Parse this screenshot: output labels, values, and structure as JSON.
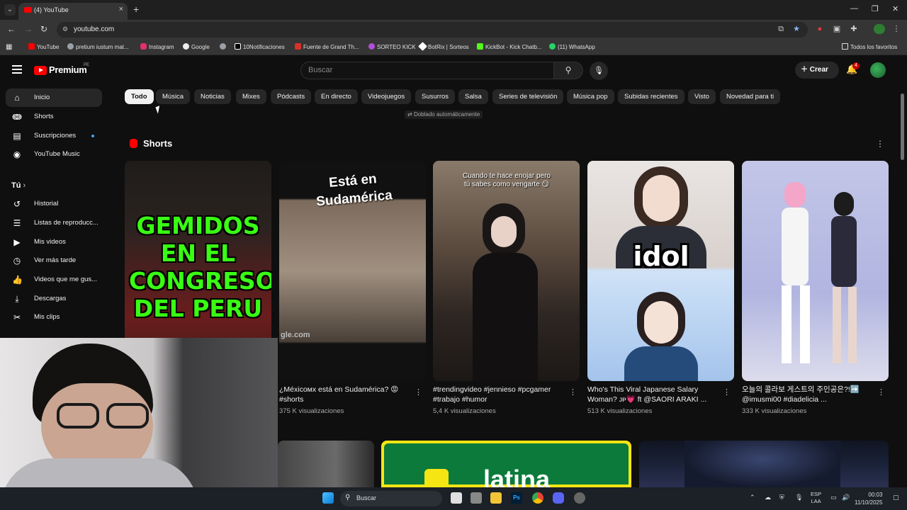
{
  "browser": {
    "tab_title": "(4) YouTube",
    "url": "youtube.com",
    "bookmarks": [
      {
        "label": "YouTube",
        "color": "#ff0000"
      },
      {
        "label": "pretium iustum mat...",
        "color": "#9aa0a6"
      },
      {
        "label": "Instagram",
        "color": "#e1306c"
      },
      {
        "label": "Google",
        "color": "#4285f4"
      },
      {
        "label": "",
        "color": "#9aa0a6"
      },
      {
        "label": "10Notificaciones",
        "color": "#ffffff"
      },
      {
        "label": "Fuente de Grand Th...",
        "color": "#d93025"
      },
      {
        "label": "SORTEO KICK",
        "color": "#b14fd8"
      },
      {
        "label": "BotRix | Sorteos",
        "color": "#ffffff"
      },
      {
        "label": "KickBot - Kick Chatb...",
        "color": "#53fc18"
      },
      {
        "label": "(11) WhatsApp",
        "color": "#25d366"
      }
    ],
    "all_bookmarks": "Todos los favoritos"
  },
  "header": {
    "logo_text": "Premium",
    "region": "PE",
    "search_placeholder": "Buscar",
    "create_label": "Crear",
    "notifications_count": "4"
  },
  "sidebar": {
    "items": [
      {
        "label": "Inicio",
        "icon": "home-icon"
      },
      {
        "label": "Shorts",
        "icon": "shorts-icon"
      },
      {
        "label": "Suscripciones",
        "icon": "subscriptions-icon"
      },
      {
        "label": "YouTube Music",
        "icon": "music-icon"
      }
    ],
    "you_label": "Tú",
    "you_items": [
      {
        "label": "Historial",
        "icon": "history-icon"
      },
      {
        "label": "Listas de reproducc...",
        "icon": "playlist-icon"
      },
      {
        "label": "Mis videos",
        "icon": "my-videos-icon"
      },
      {
        "label": "Ver más tarde",
        "icon": "watch-later-icon"
      },
      {
        "label": "Videos que me gus...",
        "icon": "like-icon"
      },
      {
        "label": "Descargas",
        "icon": "download-icon"
      },
      {
        "label": "Mis clips",
        "icon": "clips-icon"
      }
    ]
  },
  "chips": [
    "Todo",
    "Música",
    "Noticias",
    "Mixes",
    "Pódcasts",
    "En directo",
    "Videojuegos",
    "Susurros",
    "Salsa",
    "Series de televisión",
    "Música pop",
    "Subidas recientes",
    "Visto",
    "Novedad para ti"
  ],
  "dubbed_label": "Doblado automáticamente",
  "shorts": {
    "title": "Shorts",
    "items": [
      {
        "overlay": "GEMIDOS EN EL CONGRESO DEL PERU",
        "title": "",
        "views": ""
      },
      {
        "overlay": "Está en Sudamérica",
        "watermark": "gle.com",
        "title": "¿Méxicoᴍx está en Sudamérica? 😡 #shorts",
        "views": "375 K visualizaciones"
      },
      {
        "overlay": "Cuando te hace enojar pero tú sabes como vengarte 😏",
        "title": "#trendingvideo #jennieso #pcgamer #trabajo #humor",
        "views": "5,4 K visualizaciones"
      },
      {
        "overlay": "idol",
        "title": "Who's This Viral Japanese Salary Woman? ᴊᴘ💗 ft @SAORI ARAKI ...",
        "views": "513 K visualizaciones"
      },
      {
        "overlay": "",
        "title": "오늘의 콜라보 게스트의 주인공은?!➡️ @imusmi00 #diadelicia ...",
        "views": "333 K visualizaciones"
      }
    ]
  },
  "row2": {
    "banner_text": "latina"
  },
  "taskbar": {
    "search_placeholder": "Buscar",
    "lang": "ESP",
    "lang2": "LAA",
    "time": "00:03",
    "date": "11/10/2025"
  },
  "colors": {
    "accent": "#ff0000",
    "bg": "#0f0f0f",
    "chip": "#272727"
  }
}
